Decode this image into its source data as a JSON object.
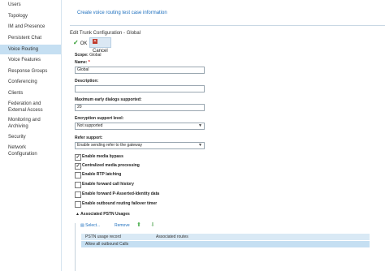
{
  "sidebar": {
    "items": [
      {
        "label": "Users"
      },
      {
        "label": "Topology"
      },
      {
        "label": "IM and Presence"
      },
      {
        "label": "Persistent Chat"
      },
      {
        "label": "Voice Routing"
      },
      {
        "label": "Voice Features"
      },
      {
        "label": "Response Groups"
      },
      {
        "label": "Conferencing"
      },
      {
        "label": "Clients"
      },
      {
        "label": "Federation and External Access"
      },
      {
        "label": "Monitoring and Archiving"
      },
      {
        "label": "Security"
      },
      {
        "label": "Network Configuration"
      }
    ],
    "active_index": 4
  },
  "header": {
    "create_link": "Create voice routing test case information",
    "section_title": "Edit Trunk Configuration - Global"
  },
  "toolbar": {
    "ok_label": "OK",
    "cancel_label": "Cancel"
  },
  "form": {
    "scope_label": "Scope:",
    "scope_value": "Global",
    "name_label": "Name:",
    "name_required": "*",
    "name_value": "Global",
    "description_label": "Description:",
    "description_value": "",
    "max_dialogs_label": "Maximum early dialogs supported:",
    "max_dialogs_value": "20",
    "encryption_label": "Encryption support level:",
    "encryption_value": "Not supported",
    "refer_label": "Refer support:",
    "refer_value": "Enable sending refer to the gateway",
    "checkboxes": [
      {
        "label": "Enable media bypass",
        "checked": true
      },
      {
        "label": "Centralized media processing",
        "checked": true
      },
      {
        "label": "Enable RTP latching",
        "checked": false
      },
      {
        "label": "Enable forward call history",
        "checked": false
      },
      {
        "label": "Enable forward P-Asserted-Identity data",
        "checked": false
      },
      {
        "label": "Enable outbound routing failover timer",
        "checked": false
      }
    ]
  },
  "pstn": {
    "title": "Associated PSTN Usages",
    "select_label": "Select...",
    "remove_label": "Remove",
    "columns": [
      "PSTN usage record",
      "Associated routes"
    ],
    "rows": [
      {
        "record": "Allow all outbound Calls",
        "routes": ""
      }
    ]
  }
}
